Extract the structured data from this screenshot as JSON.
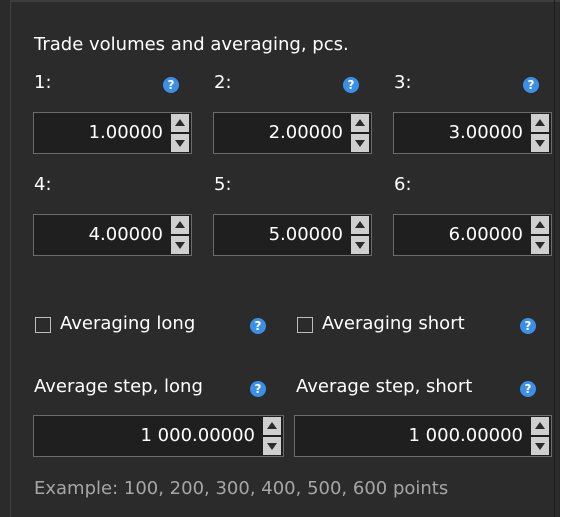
{
  "section_title": "Trade volumes and averaging, pcs.",
  "volumes": [
    {
      "label": "1:",
      "value": "1.00000"
    },
    {
      "label": "2:",
      "value": "2.00000"
    },
    {
      "label": "3:",
      "value": "3.00000"
    },
    {
      "label": "4:",
      "value": "4.00000"
    },
    {
      "label": "5:",
      "value": "5.00000"
    },
    {
      "label": "6:",
      "value": "6.00000"
    }
  ],
  "averaging_long_label": "Averaging long",
  "averaging_short_label": "Averaging short",
  "averaging_long_checked": false,
  "averaging_short_checked": false,
  "avg_step_long_label": "Average step, long",
  "avg_step_short_label": "Average step, short",
  "avg_step_long_value": "1 000.00000",
  "avg_step_short_value": "1 000.00000",
  "example_text": "Example: 100, 200, 300, 400, 500, 600 points",
  "help_glyph": "?",
  "icons": {
    "help": "help-circle-icon",
    "up": "arrow-up-icon",
    "down": "arrow-down-icon"
  },
  "colors": {
    "panel_bg": "#2b2b2b",
    "help_blue": "#3c8fe6",
    "text": "#ffffff",
    "muted": "#a6a6a6"
  }
}
